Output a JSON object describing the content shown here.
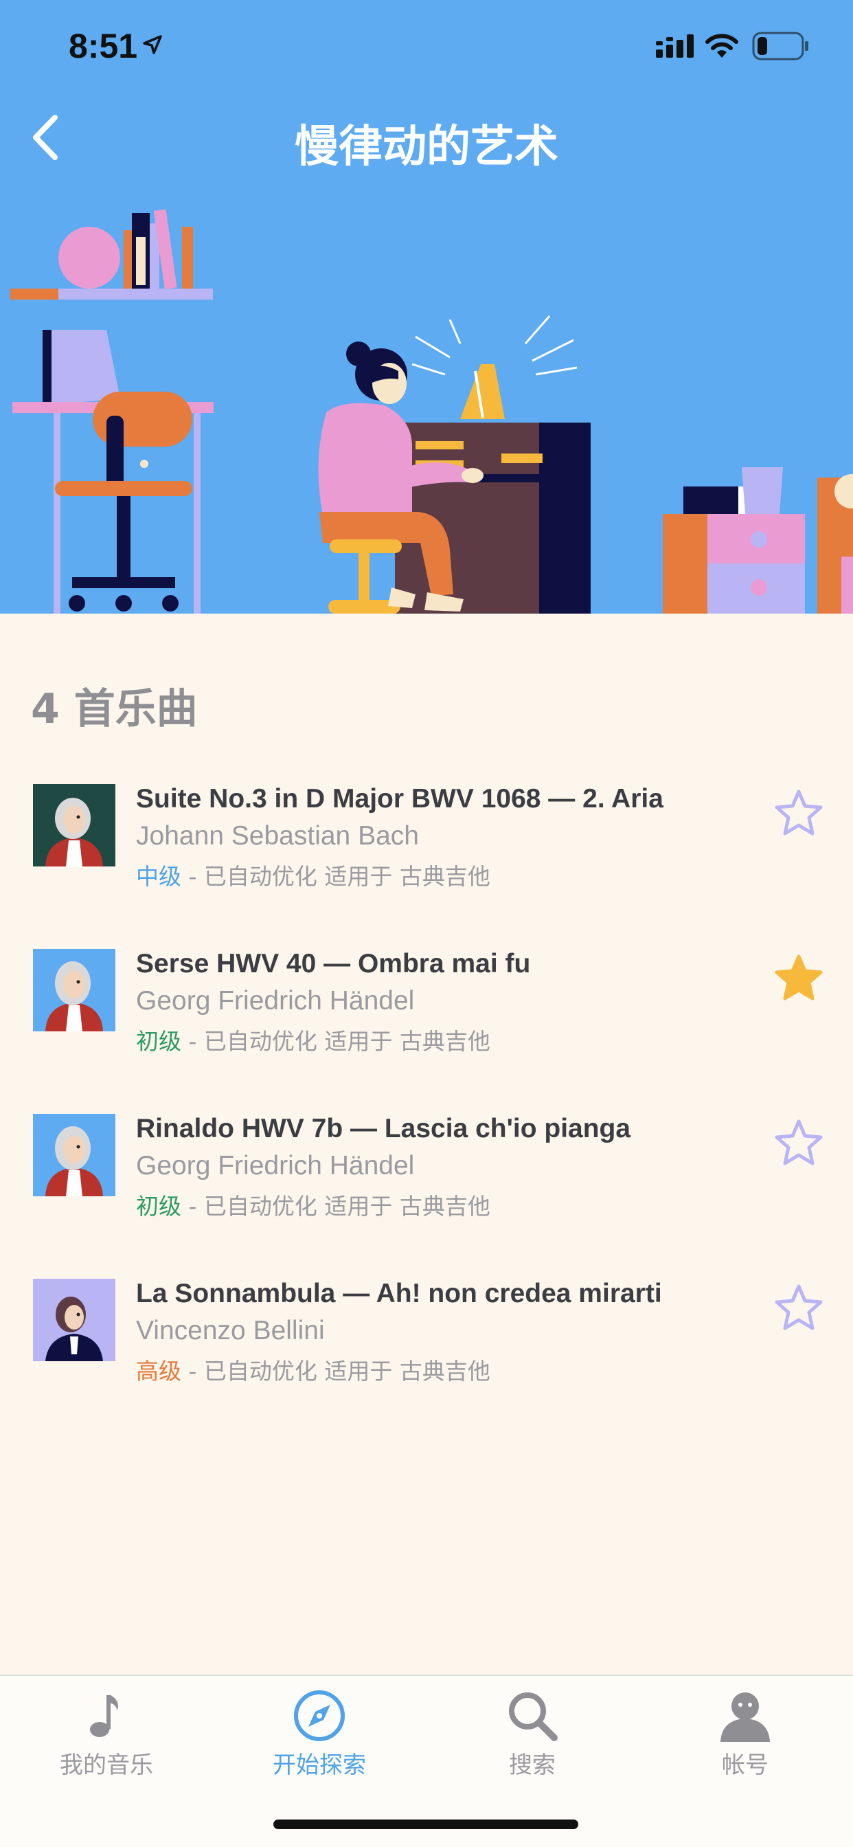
{
  "status_bar": {
    "time": "8:51"
  },
  "header": {
    "title": "慢律动的艺术"
  },
  "content": {
    "count_heading": "4 首乐曲",
    "songs": [
      {
        "title": "Suite No.3 in D Major BWV 1068 — 2. Aria",
        "composer": "Johann Sebastian Bach",
        "level": "中级",
        "meta": " - 已自动优化 适用于 古典吉他",
        "favorited": false
      },
      {
        "title": "Serse HWV 40 — Ombra mai fu",
        "composer": "Georg Friedrich Händel",
        "level": "初级",
        "meta": " - 已自动优化 适用于 古典吉他",
        "favorited": true
      },
      {
        "title": "Rinaldo HWV 7b — Lascia ch'io pianga",
        "composer": "Georg Friedrich Händel",
        "level": "初级",
        "meta": " - 已自动优化 适用于 古典吉他",
        "favorited": false
      },
      {
        "title": "La Sonnambula — Ah! non credea mirarti",
        "composer": "Vincenzo Bellini",
        "level": "高级",
        "meta": " - 已自动优化 适用于 古典吉他",
        "favorited": false
      }
    ]
  },
  "tab_bar": {
    "tabs": [
      {
        "label": "我的音乐",
        "icon": "music-note-icon",
        "active": false
      },
      {
        "label": "开始探索",
        "icon": "compass-icon",
        "active": true
      },
      {
        "label": "搜索",
        "icon": "search-icon",
        "active": false
      },
      {
        "label": "帐号",
        "icon": "account-icon",
        "active": false
      }
    ]
  },
  "colors": {
    "header_bg": "#5eabf1",
    "page_bg": "#fdf6ec",
    "accent": "#4fa3e6",
    "level_intermediate": "#4fa3e6",
    "level_beginner": "#2e9b63",
    "level_advanced": "#e57b3c",
    "star_filled": "#f6b93b",
    "star_outline": "#b9b4f3"
  }
}
